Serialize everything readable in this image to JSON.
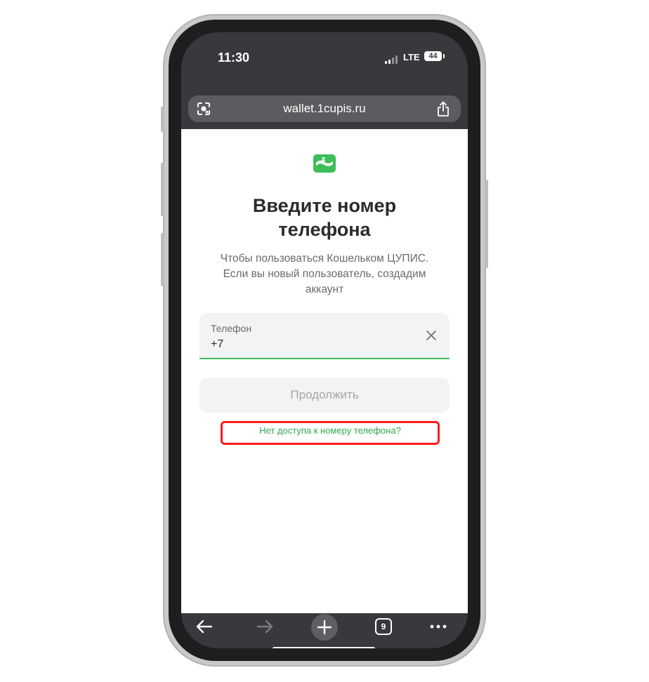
{
  "status_bar": {
    "time": "11:30",
    "network": "LTE",
    "battery": "44"
  },
  "browser": {
    "url": "wallet.1cupis.ru",
    "tab_count": "9"
  },
  "page": {
    "title_line1": "Введите номер",
    "title_line2": "телефона",
    "subtitle": "Чтобы пользоваться Кошельком ЦУПИС. Если вы новый пользователь, создадим аккаунт",
    "phone_field": {
      "label": "Телефон",
      "value": "+7"
    },
    "continue_label": "Продолжить",
    "no_access_link": "Нет доступа к номеру телефона?"
  },
  "colors": {
    "brand_green": "#3dbe5a",
    "link_green": "#2fa84a",
    "highlight_red": "#ff1a1a",
    "browser_chrome": "#37393c"
  },
  "icons": {
    "url_left": "lens-icon",
    "url_right": "share-icon",
    "field_clear": "close-icon",
    "toolbar": [
      "back-arrow-icon",
      "forward-arrow-icon",
      "plus-icon",
      "tabs-icon",
      "more-dots-icon"
    ]
  }
}
